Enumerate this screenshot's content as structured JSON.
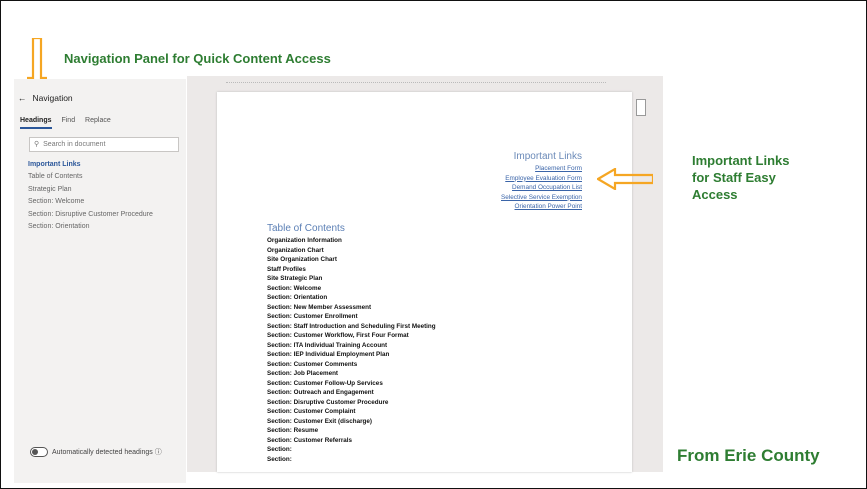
{
  "annotations": {
    "top": "Navigation Panel for Quick Content Access",
    "right_line1": "Important Links",
    "right_line2": "for Staff Easy",
    "right_line3": "Access",
    "footer": "From Erie County",
    "arrow_color": "#f5a623",
    "text_color": "#2e7d32"
  },
  "navigation": {
    "title": "Navigation",
    "tabs": [
      "Headings",
      "Find",
      "Replace"
    ],
    "search_placeholder": "Search in document",
    "items": [
      "Important Links",
      "Table of Contents",
      "Strategic Plan",
      "Section: Welcome",
      "Section: Disruptive Customer Procedure",
      "Section: Orientation"
    ],
    "auto_headings_label": "Automatically detected headings"
  },
  "document": {
    "links_title": "Important Links",
    "links": [
      "Placement Form",
      "Employee Evaluation Form",
      "Demand Occupation List",
      "Selective Service Exemption",
      "Orientation Power Point"
    ],
    "toc_title": "Table of Contents",
    "toc_items": [
      "Organization Information",
      "Organization Chart",
      "Site Organization Chart",
      "Staff Profiles",
      "Site Strategic Plan",
      "Section: Welcome",
      "Section: Orientation",
      "Section: New Member Assessment",
      "Section: Customer Enrollment",
      "Section: Staff Introduction and Scheduling First Meeting",
      "Section: Customer Workflow, First Four Format",
      "Section: ITA Individual Training Account",
      "Section: IEP Individual Employment Plan",
      "Section: Customer Comments",
      "Section: Job Placement",
      "Section: Customer Follow-Up Services",
      "Section: Outreach and Engagement",
      "Section: Disruptive Customer Procedure",
      "Section: Customer Complaint",
      "Section: Customer Exit (discharge)",
      "Section: Resume",
      "Section: Customer Referrals",
      "Section:",
      "Section:"
    ]
  }
}
